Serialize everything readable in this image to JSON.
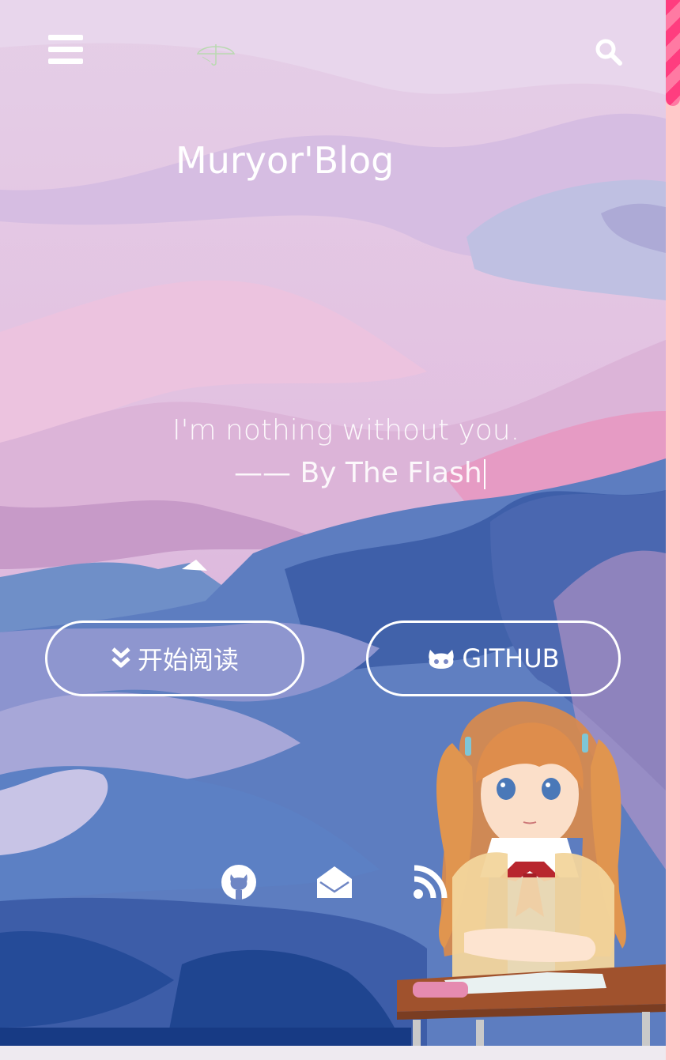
{
  "header": {
    "menu_icon": "hamburger-menu-icon",
    "logo_icon": "umbrella-logo-icon",
    "search_icon": "search-icon"
  },
  "site": {
    "title": "Muryor'Blog"
  },
  "quote": {
    "line1": "I'm nothing without you.",
    "line2": "—— By The Flash"
  },
  "buttons": {
    "read": {
      "icon": "double-chevron-down-icon",
      "label": "开始阅读"
    },
    "github": {
      "icon": "github-cat-icon",
      "label": "GITHUB"
    }
  },
  "social": [
    {
      "icon": "github-icon"
    },
    {
      "icon": "envelope-open-icon"
    },
    {
      "icon": "rss-icon"
    }
  ],
  "colors": {
    "sky_top": "#e6d0e8",
    "mountain_blue": "#3f5ea8",
    "accent_pink": "#ff3d7f",
    "scroll_track": "#ffc9c9"
  }
}
